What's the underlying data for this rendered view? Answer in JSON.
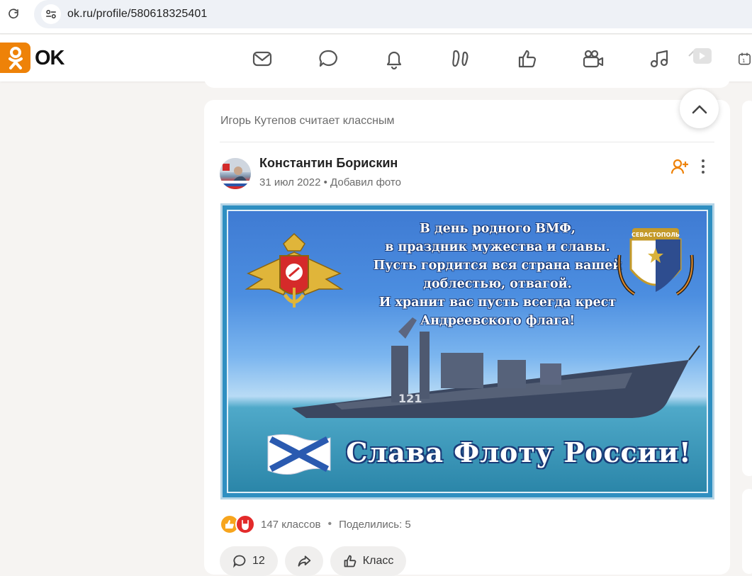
{
  "browser": {
    "url": "ok.ru/profile/580618325401"
  },
  "header": {
    "logo_text": "OK",
    "nav_icons": [
      "mail-icon",
      "chat-icon",
      "bell-icon",
      "guests-icon",
      "like-icon",
      "video-icon",
      "music-icon",
      "video-play-icon",
      "calendar-icon"
    ]
  },
  "post": {
    "liked_by": "Игорь Кутепов считает классным",
    "author": "Константин Борискин",
    "date": "31 июл 2022",
    "action": "Добавил фото",
    "image": {
      "poem_lines": [
        "В день родного ВМФ,",
        "в праздник мужества и славы.",
        "Пусть гордится вся страна вашей",
        "доблестью, отвагой.",
        "И хранит вас пусть всегда крест",
        "Андреевского флага!"
      ],
      "slogan": "Слава Флоту России!",
      "emblem_ribbon": "СЕВАСТОПОЛЬ",
      "ship_number": "121"
    },
    "reactions": {
      "classes": "147 классов",
      "shared": "Поделились: 5"
    },
    "actions": {
      "comments": "12",
      "class_label": "Класс"
    }
  },
  "colors": {
    "ok_orange": "#ee8208",
    "card_bg": "#ffffff",
    "page_bg": "#f6f4f2"
  }
}
